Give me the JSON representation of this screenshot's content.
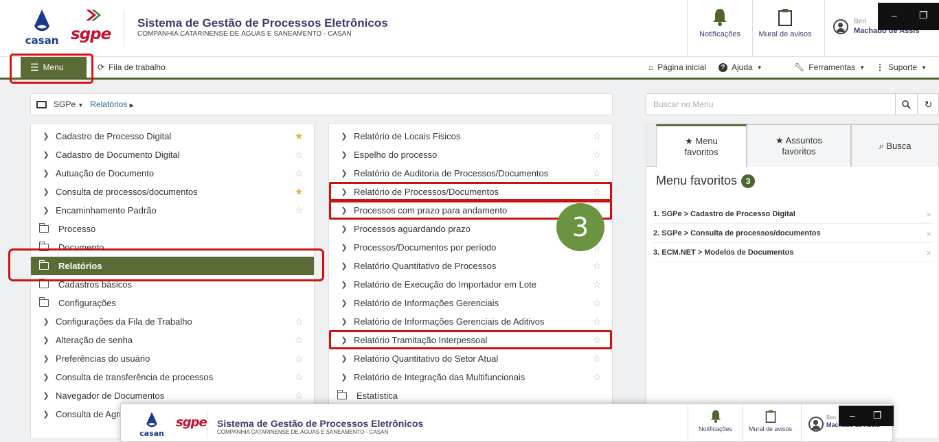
{
  "header": {
    "casan_label": "casan",
    "sgpe_label": "sgpe",
    "system_title": "Sistema de Gestão de Processos Eletrônicos",
    "company": "COMPANHIA CATARINENSE DE ÁGUAS E SANEAMENTO - CASAN",
    "notifications_label": "Notificações",
    "mural_label": "Mural de avisos",
    "greeting": "Ben",
    "user_name": "Machado de Assis",
    "minimize": "–",
    "restore": "❐"
  },
  "nav": {
    "menu_label": "Menu",
    "fila_label": "Fila de trabalho",
    "home_label": "Página inicial",
    "help_label": "Ajuda",
    "tools_label": "Ferramentas",
    "support_label": "Suporte"
  },
  "breadcrumb": {
    "root": "SGPe",
    "current": "Relatórios"
  },
  "search": {
    "placeholder": "Buscar no Menu"
  },
  "left_column": [
    {
      "type": "item",
      "label": "Cadastro de Processo Digital",
      "fav": true
    },
    {
      "type": "item",
      "label": "Cadastro de Documento Digital",
      "fav": false
    },
    {
      "type": "item",
      "label": "Autuação de Documento",
      "fav": false
    },
    {
      "type": "item",
      "label": "Consulta de processos/documentos",
      "fav": true
    },
    {
      "type": "item",
      "label": "Encaminhamento Padrão",
      "fav": false
    },
    {
      "type": "folder",
      "label": "Processo"
    },
    {
      "type": "folder",
      "label": "Documento"
    },
    {
      "type": "folder",
      "label": "Relatórios",
      "active": true
    },
    {
      "type": "folder",
      "label": "Cadastros básicos"
    },
    {
      "type": "folder",
      "label": "Configurações"
    },
    {
      "type": "item",
      "label": "Configurações da Fila de Trabalho",
      "fav": false
    },
    {
      "type": "item",
      "label": "Alteração de senha",
      "fav": false
    },
    {
      "type": "item",
      "label": "Preferências do usuário",
      "fav": false
    },
    {
      "type": "item",
      "label": "Consulta de transferência de processos",
      "fav": false
    },
    {
      "type": "item",
      "label": "Navegador de Documentos",
      "fav": false
    },
    {
      "type": "item",
      "label": "Consulta de Agru",
      "fav": false
    }
  ],
  "mid_column": [
    {
      "type": "item",
      "label": "Relatório de Locais Fisicos",
      "fav": false
    },
    {
      "type": "item",
      "label": "Espelho do processo",
      "fav": false
    },
    {
      "type": "item",
      "label": "Relatório de Auditoria de Processos/Documentos",
      "fav": false
    },
    {
      "type": "item",
      "label": "Relatório de Processos/Documentos",
      "fav": false,
      "highlight": true
    },
    {
      "type": "item",
      "label": "Processos com prazo para andamento",
      "fav": false,
      "highlight": true
    },
    {
      "type": "item",
      "label": "Processos aguardando prazo",
      "fav": false
    },
    {
      "type": "item",
      "label": "Processos/Documentos por período",
      "fav": false
    },
    {
      "type": "item",
      "label": "Relatório Quantitativo de Processos",
      "fav": false
    },
    {
      "type": "item",
      "label": "Relatório de Execução do Importador em Lote",
      "fav": false
    },
    {
      "type": "item",
      "label": "Relatório de Informações Gerenciais",
      "fav": false
    },
    {
      "type": "item",
      "label": "Relatório de Informações Gerenciais de Aditivos",
      "fav": false
    },
    {
      "type": "item",
      "label": "Relatório Tramitação Interpessoal",
      "fav": false,
      "highlight": true
    },
    {
      "type": "item",
      "label": "Relatório Quantitativo do Setor Atual",
      "fav": false
    },
    {
      "type": "item",
      "label": "Relatório de Integração das Multifuncionais",
      "fav": false
    },
    {
      "type": "folder",
      "label": "Estatística"
    }
  ],
  "step_badge": "3",
  "favorites": {
    "tab_menu": [
      "Menu",
      "favoritos"
    ],
    "tab_assuntos": [
      "Assuntos",
      "favoritos"
    ],
    "tab_busca": "Busca",
    "title": "Menu favoritos",
    "count": "3",
    "items": [
      "1. SGPe > Cadastro de Processo Digital",
      "2. SGPe > Consulta de processos/documentos",
      "3. ECM.NET > Modelos de Documentos"
    ],
    "remove": "×"
  },
  "colors": {
    "accent": "#5b6b35",
    "highlight": "#cc1111",
    "star_fav": "#e8b23a"
  }
}
